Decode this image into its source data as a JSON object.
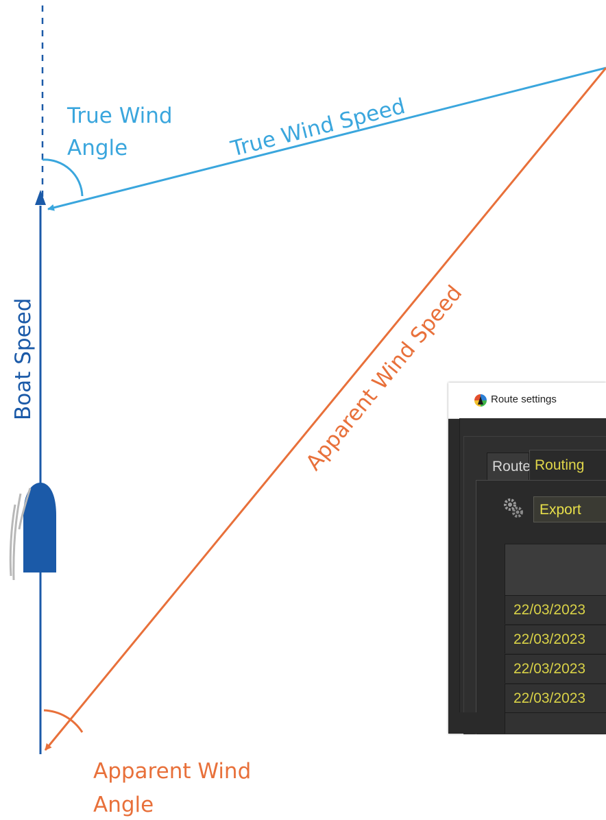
{
  "diagram": {
    "labels": {
      "true_wind_angle_line1": "True Wind",
      "true_wind_angle_line2": "Angle",
      "true_wind_speed": "True Wind Speed",
      "boat_speed": "Boat Speed",
      "apparent_wind_speed": "Apparent Wind Speed",
      "apparent_wind_angle_line1": "Apparent Wind",
      "apparent_wind_angle_line2": "Angle"
    },
    "colors": {
      "true_wind": "#3aa6dd",
      "boat": "#1b5aa8",
      "apparent_wind": "#e8703a",
      "sail": "#b8b8b8"
    }
  },
  "window": {
    "title": "Route settings",
    "tabs": [
      {
        "label": "Route",
        "active": false
      },
      {
        "label": "Routing",
        "active": true
      }
    ],
    "toolbar": {
      "export_label": "Export"
    },
    "rows": [
      {
        "date": "22/03/2023"
      },
      {
        "date": "22/03/2023"
      },
      {
        "date": "22/03/2023"
      },
      {
        "date": "22/03/2023"
      }
    ]
  }
}
